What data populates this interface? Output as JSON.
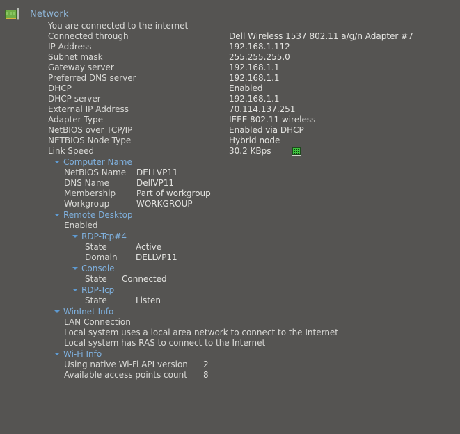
{
  "header": {
    "icon": "network-adapter-icon",
    "title": "Network"
  },
  "status_line": "You are connected to the internet",
  "network": {
    "rows": [
      {
        "label": "Connected through",
        "value": "Dell Wireless 1537 802.11 a/g/n Adapter #7"
      },
      {
        "label": "IP Address",
        "value": "192.168.1.112"
      },
      {
        "label": "Subnet mask",
        "value": "255.255.255.0"
      },
      {
        "label": "Gateway server",
        "value": "192.168.1.1"
      },
      {
        "label": "Preferred DNS server",
        "value": "192.168.1.1"
      },
      {
        "label": "DHCP",
        "value": "Enabled"
      },
      {
        "label": "DHCP server",
        "value": "192.168.1.1"
      },
      {
        "label": "External IP Address",
        "value": "70.114.137.251"
      },
      {
        "label": "Adapter Type",
        "value": "IEEE 802.11 wireless"
      },
      {
        "label": "NetBIOS over TCP/IP",
        "value": "Enabled via DHCP"
      },
      {
        "label": "NETBIOS Node Type",
        "value": "Hybrid node"
      },
      {
        "label": "Link Speed",
        "value": "30.2 KBps"
      }
    ]
  },
  "computer_name": {
    "section_label": "Computer Name",
    "rows": [
      {
        "label": "NetBIOS Name",
        "value": "DELLVP11"
      },
      {
        "label": "DNS Name",
        "value": "DellVP11"
      },
      {
        "label": "Membership",
        "value": "Part of workgroup"
      },
      {
        "label": "Workgroup",
        "value": "WORKGROUP"
      }
    ]
  },
  "remote_desktop": {
    "section_label": "Remote Desktop",
    "enabled_text": "Enabled",
    "sessions": [
      {
        "name": "RDP-Tcp#4",
        "rows": [
          {
            "label": "State",
            "value": "Active"
          },
          {
            "label": "Domain",
            "value": "DELLVP11"
          }
        ]
      },
      {
        "name": "Console",
        "rows": [
          {
            "label": "State",
            "value": "Connected"
          }
        ]
      },
      {
        "name": "RDP-Tcp",
        "rows": [
          {
            "label": "State",
            "value": "Listen"
          }
        ]
      }
    ]
  },
  "wininet_info": {
    "section_label": "WinInet Info",
    "lines": [
      "LAN Connection",
      "Local system uses a local area network to connect to the Internet",
      "Local system has RAS to connect to the Internet"
    ]
  },
  "wifi_info": {
    "section_label": "Wi-Fi Info",
    "rows": [
      {
        "label": "Using native Wi-Fi API version",
        "value": "2"
      },
      {
        "label": "Available access points count",
        "value": "8"
      }
    ]
  },
  "colors": {
    "background": "#555452",
    "text": "#d9d9d6",
    "section_header": "#7fb0dd",
    "title": "#8fb6d8",
    "accent_green": "#6fae47"
  }
}
